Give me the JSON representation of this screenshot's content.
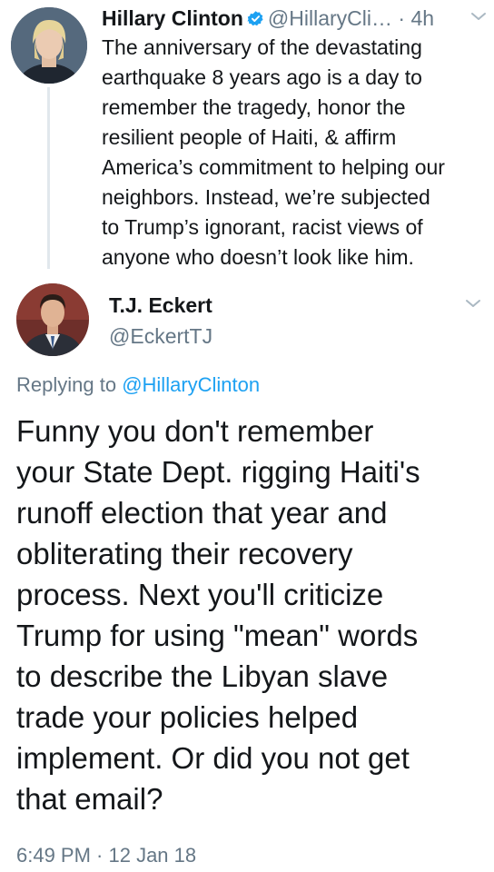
{
  "parent_tweet": {
    "name": "Hillary Clinton",
    "verified": true,
    "handle": "@HillaryCli…",
    "separator": "·",
    "time": "4h",
    "text": "The anniversary of the devastating\nearthquake 8 years ago is a day to\nremember the tragedy, honor the\nresilient people of Haiti, & affirm\nAmerica’s commitment to helping our\nneighbors. Instead, we’re subjected\nto Trump’s ignorant, racist views of\nanyone who doesn’t look like him."
  },
  "reply_tweet": {
    "name": "T.J. Eckert",
    "handle": "@EckertTJ",
    "replying_prefix": "Replying to",
    "replying_to": "@HillaryClinton",
    "text": "Funny you don't remember\nyour State Dept. rigging Haiti's\nrunoff election that year and\nobliterating their recovery\nprocess. Next you'll criticize\nTrump for using \"mean\" words\nto describe the Libyan slave\ntrade your policies helped\nimplement. Or did you not get\nthat email?",
    "timestamp": "6:49 PM · 12 Jan 18"
  },
  "colors": {
    "text": "#14171a",
    "secondary": "#657786",
    "link": "#1da1f2",
    "verified": "#1da1f2",
    "thread_line": "#e1e8ed"
  },
  "icons": {
    "verified": "verified-badge-icon",
    "more": "chevron-down-icon"
  }
}
